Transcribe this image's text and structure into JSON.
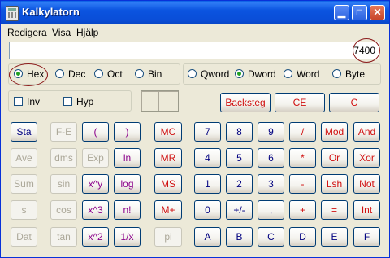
{
  "window": {
    "title": "Kalkylatorn"
  },
  "menu": [
    {
      "label": "Redigera",
      "accel": "R",
      "rest": "edigera"
    },
    {
      "label": "Visa",
      "accel": "",
      "pre": "Vi",
      "acc2": "s",
      "rest": "a"
    },
    {
      "label": "Hjälp",
      "accel": "H",
      "rest": "jälp"
    }
  ],
  "display": {
    "value": "7400"
  },
  "number_system": {
    "options": [
      "Hex",
      "Dec",
      "Oct",
      "Bin"
    ],
    "selected": "Hex"
  },
  "word_size": {
    "options": [
      "Qword",
      "Dword",
      "Word",
      "Byte"
    ],
    "selected": "Dword"
  },
  "checks": {
    "inv": "Inv",
    "hyp": "Hyp"
  },
  "top_buttons": {
    "backspace": "Backsteg",
    "ce": "CE",
    "c": "C"
  },
  "sci_buttons": [
    "Sta",
    "F-E",
    "(",
    ")",
    "Ave",
    "dms",
    "Exp",
    "ln",
    "Sum",
    "sin",
    "x^y",
    "log",
    "s",
    "cos",
    "x^3",
    "n!",
    "Dat",
    "tan",
    "x^2",
    "1/x"
  ],
  "mem_buttons": [
    "MC",
    "MR",
    "MS",
    "M+",
    "pi"
  ],
  "pad": [
    [
      "7",
      "8",
      "9",
      "/",
      "Mod",
      "And"
    ],
    [
      "4",
      "5",
      "6",
      "*",
      "Or",
      "Xor"
    ],
    [
      "1",
      "2",
      "3",
      "-",
      "Lsh",
      "Not"
    ],
    [
      "0",
      "+/-",
      ",",
      "+",
      "=",
      "Int"
    ],
    [
      "A",
      "B",
      "C",
      "D",
      "E",
      "F"
    ]
  ]
}
